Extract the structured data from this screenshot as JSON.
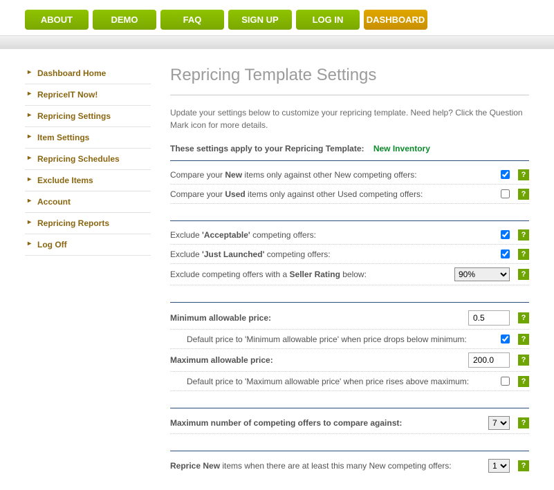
{
  "nav": {
    "about": "ABOUT",
    "demo": "DEMO",
    "faq": "FAQ",
    "signup": "SIGN UP",
    "login": "LOG IN",
    "dashboard": "DASHBOARD"
  },
  "sidebar": {
    "items": [
      "Dashboard Home",
      "RepriceIT Now!",
      "Repricing Settings",
      "Item Settings",
      "Repricing Schedules",
      "Exclude Items",
      "Account",
      "Repricing Reports",
      "Log Off"
    ]
  },
  "page": {
    "title": "Repricing Template Settings",
    "intro": "Update your settings below to customize your repricing template. Need help? Click the Question Mark icon for more details.",
    "template_prefix": "These settings apply to your Repricing Template:",
    "template_name": "New Inventory"
  },
  "rows": {
    "compare_new_pre": "Compare your ",
    "compare_new_bold": "New",
    "compare_new_post": " items only against other New competing offers:",
    "compare_used_pre": "Compare your ",
    "compare_used_bold": "Used",
    "compare_used_post": " items only against other Used competing offers:",
    "exclude_acceptable_pre": "Exclude ",
    "exclude_acceptable_bold": "'Acceptable'",
    "exclude_acceptable_post": " competing offers:",
    "exclude_just_launched_pre": "Exclude ",
    "exclude_just_launched_bold": "'Just Launched'",
    "exclude_just_launched_post": " competing offers:",
    "exclude_rating_pre": "Exclude competing offers with a ",
    "exclude_rating_bold": "Seller Rating",
    "exclude_rating_post": " below:",
    "min_price": "Minimum allowable price:",
    "min_default": "Default price to 'Minimum allowable price' when price drops below minimum:",
    "max_price": "Maximum allowable price:",
    "max_default": "Default price to 'Maximum allowable price' when price rises above maximum:",
    "max_offers": "Maximum number of competing offers to compare against:",
    "reprice_new_pre": "Reprice New",
    "reprice_new_post": " items when there are at least this many New competing offers:"
  },
  "values": {
    "compare_new": true,
    "compare_used": false,
    "exclude_acceptable": true,
    "exclude_just_launched": true,
    "seller_rating": "90%",
    "min_price": "0.5",
    "min_default": true,
    "max_price": "200.0",
    "max_default": false,
    "max_offers": "7",
    "reprice_new_count": "1"
  },
  "help": "?"
}
